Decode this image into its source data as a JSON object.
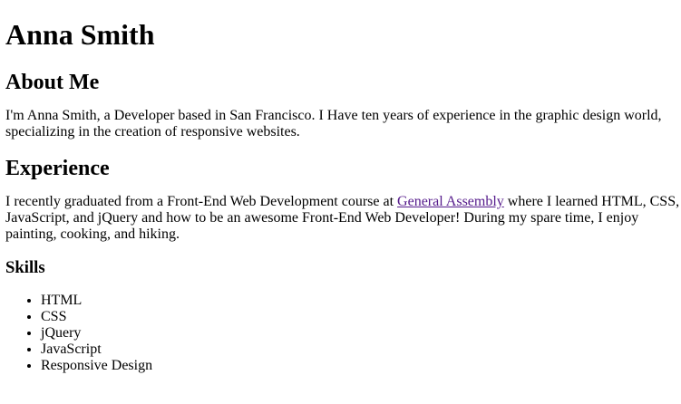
{
  "header": {
    "name": "Anna Smith"
  },
  "about": {
    "heading": "About Me",
    "text": "I'm Anna Smith, a Developer based in San Francisco. I Have ten years of experience in the graphic design world, specializing in the creation of responsive websites."
  },
  "experience": {
    "heading": "Experience",
    "text_before": "I recently graduated from a Front-End Web Development course at ",
    "link_text": "General Assembly",
    "link_color": "#551a8b",
    "text_after": " where I learned HTML, CSS, JavaScript, and jQuery and how to be an awesome Front-End Web Developer! During my spare time, I enjoy painting, cooking, and hiking."
  },
  "skills": {
    "heading": "Skills",
    "items": [
      "HTML",
      "CSS",
      "jQuery",
      "JavaScript",
      "Responsive Design"
    ]
  }
}
